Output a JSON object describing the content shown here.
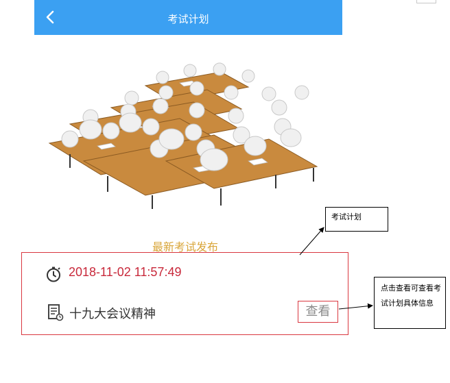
{
  "header": {
    "title": "考试计划",
    "back_icon": "chevron-left-icon",
    "color": "#3ba0f2"
  },
  "main": {
    "section_title": "最新考试发布",
    "exam": {
      "datetime": "2018-11-02 11:57:49",
      "name": "十九大会议精神",
      "view_label": "查看"
    }
  },
  "annotations": {
    "plan_note": "考试计划",
    "view_note": "点击查看可查看考试计划具体信息"
  },
  "colors": {
    "accent_gold": "#d9a63a",
    "datetime_red": "#c8283a",
    "border_red": "#d9363e"
  }
}
